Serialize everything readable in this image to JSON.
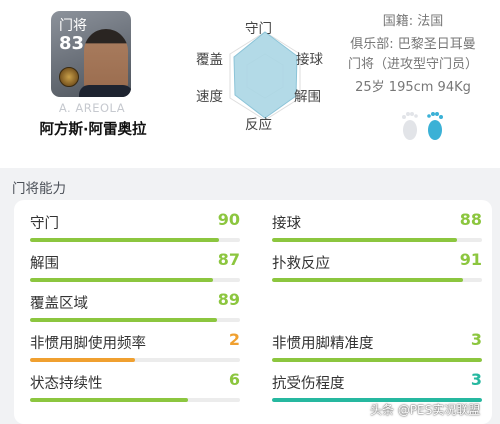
{
  "player": {
    "position": "门将",
    "rating": "83",
    "english_name": "A. AREOLA",
    "chinese_name": "阿方斯·阿雷奥拉"
  },
  "radar": {
    "labels": {
      "top": "守门",
      "right_top": "接球",
      "right_bottom": "解围",
      "bottom": "反应",
      "left_bottom": "速度",
      "left_top": "覆盖"
    },
    "fill_color": "#9fcfe0",
    "grid_color": "#d9d9d9"
  },
  "info": {
    "nationality": "国籍: 法国",
    "club": "俱乐部: 巴黎圣日耳曼",
    "style": "门将（进攻型守门员）",
    "physical": "25岁 195cm 94Kg"
  },
  "foot_icon": "feet-preference-icon",
  "section": {
    "title": "门将能力"
  },
  "stats": [
    {
      "label": "守门",
      "value": "90",
      "level": 0.9,
      "color": "#8cc63f"
    },
    {
      "label": "接球",
      "value": "88",
      "level": 0.88,
      "color": "#8cc63f"
    },
    {
      "label": "解围",
      "value": "87",
      "level": 0.87,
      "color": "#8cc63f"
    },
    {
      "label": "扑救反应",
      "value": "91",
      "level": 0.91,
      "color": "#8cc63f"
    },
    {
      "label": "覆盖区域",
      "value": "89",
      "level": 0.89,
      "color": "#8cc63f"
    },
    {
      "label": "非惯用脚使用频率",
      "value": "2",
      "level": 0.5,
      "color": "#f0a030"
    },
    {
      "label": "非惯用脚精准度",
      "value": "3",
      "level": 1.0,
      "color": "#8cc63f"
    },
    {
      "label": "状态持续性",
      "value": "6",
      "level": 0.75,
      "color": "#8cc63f"
    },
    {
      "label": "抗受伤程度",
      "value": "3",
      "level": 1.0,
      "color": "#26b8a0"
    }
  ],
  "watermark": "头条 @PES实况联盟"
}
